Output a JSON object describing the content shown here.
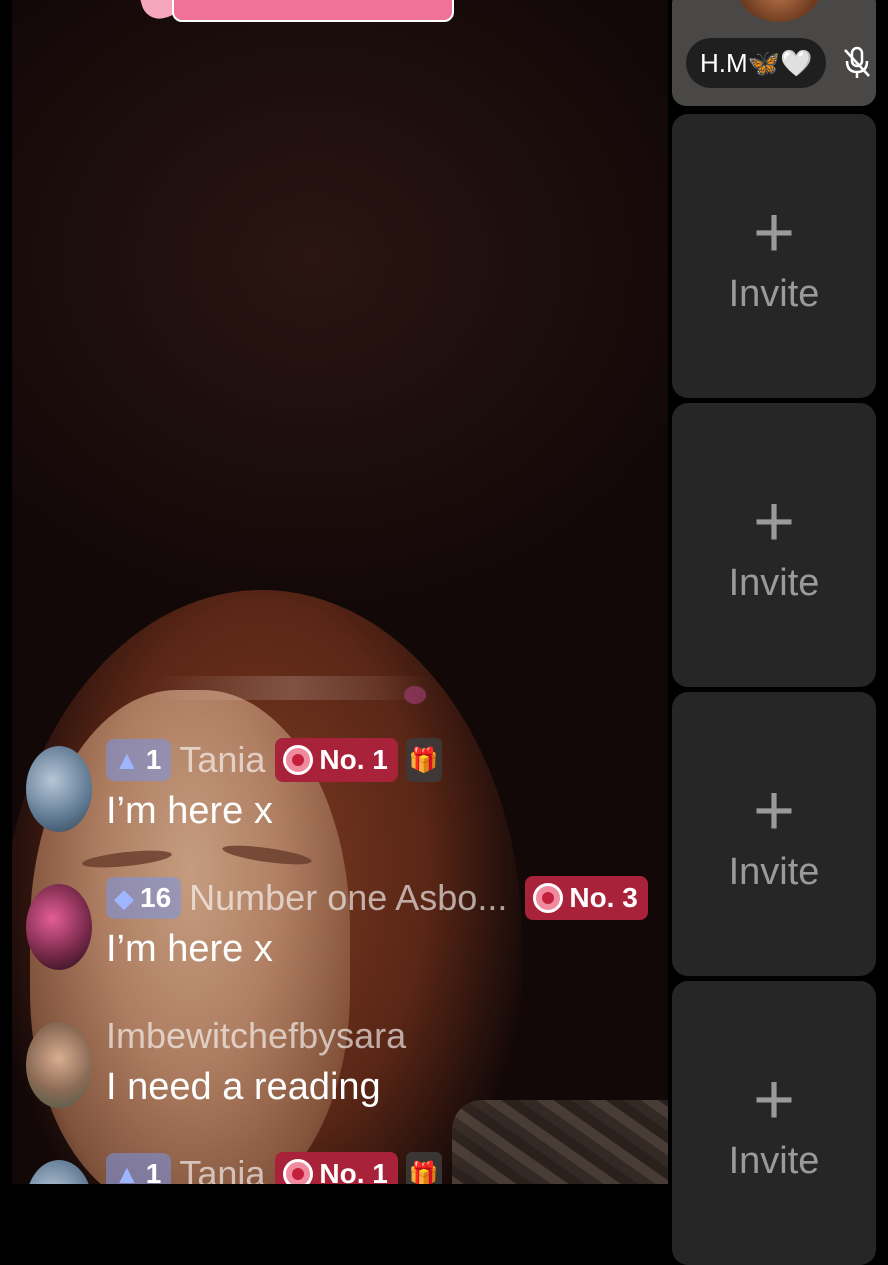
{
  "chat": {
    "messages": [
      {
        "level": "1",
        "user": "Tania",
        "rank": "No. 1",
        "has_gift_badge": true,
        "text": "I’m here x",
        "avatar_color": "#5d7891"
      },
      {
        "level": "16",
        "user": "Number one Asbo...",
        "rank": "No. 3",
        "has_gift_badge": false,
        "text": "I’m here x",
        "avatar_color": "#7a2a4c"
      },
      {
        "user": "Imbewitchefbysara",
        "text": "I need a reading",
        "avatar_color": "#8a6a55"
      },
      {
        "level": "1",
        "user": "Tania",
        "rank": "No. 1",
        "has_gift_badge": true,
        "text": "",
        "avatar_color": "#5d7891"
      }
    ]
  },
  "guests": {
    "host": {
      "name": "H.M🦋🤍",
      "mic": "muted"
    },
    "slots": [
      {
        "plus": "+",
        "label": "Invite"
      },
      {
        "plus": "+",
        "label": "Invite"
      },
      {
        "plus": "+",
        "label": "Invite"
      },
      {
        "plus": "+",
        "label": "Invite"
      }
    ]
  },
  "colors": {
    "rank_badge": "#a8223a",
    "level_badge": "#7896e6",
    "invite_card": "#262626",
    "banner": "#f0729a"
  },
  "icons": {
    "level_1": "navigation-arrow-icon",
    "level_16": "diamond-icon",
    "rank": "medal-icon",
    "gift": "gift-icon",
    "mic": "mic-off-icon"
  }
}
